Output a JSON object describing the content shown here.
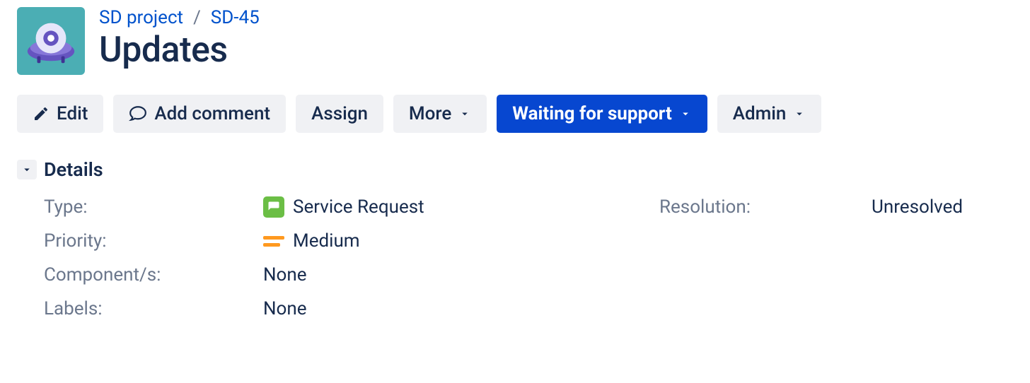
{
  "breadcrumb": {
    "project": "SD project",
    "issue_key": "SD-45"
  },
  "issue": {
    "title": "Updates"
  },
  "toolbar": {
    "edit": "Edit",
    "add_comment": "Add comment",
    "assign": "Assign",
    "more": "More",
    "status": "Waiting for support",
    "admin": "Admin"
  },
  "section": {
    "details_title": "Details"
  },
  "details": {
    "type_label": "Type:",
    "type_value": "Service Request",
    "resolution_label": "Resolution:",
    "resolution_value": "Unresolved",
    "priority_label": "Priority:",
    "priority_value": "Medium",
    "components_label": "Component/s:",
    "components_value": "None",
    "labels_label": "Labels:",
    "labels_value": "None"
  }
}
